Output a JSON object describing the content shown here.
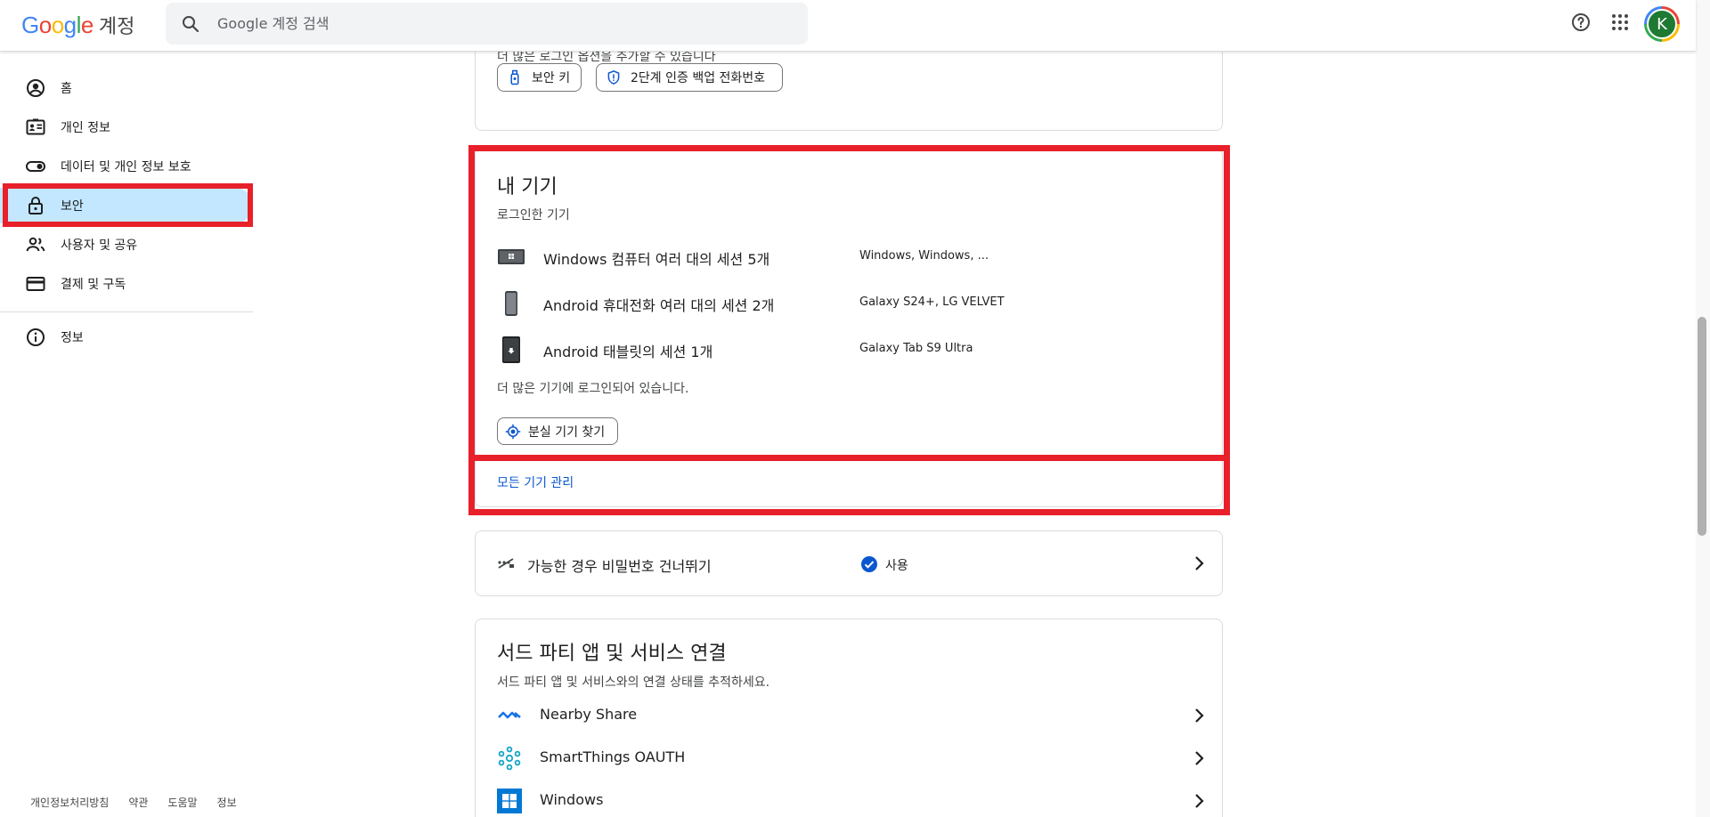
{
  "header": {
    "logo_text": "Google",
    "product": "계정",
    "search_placeholder": "Google 계정 검색",
    "avatar_initial": "K",
    "icons": [
      "search-icon",
      "help-icon",
      "apps-grid-icon"
    ]
  },
  "sidebar": {
    "items": [
      {
        "label": "홈",
        "icon": "account-circle-icon"
      },
      {
        "label": "개인 정보",
        "icon": "id-card-icon"
      },
      {
        "label": "데이터 및 개인 정보 보호",
        "icon": "toggle-icon"
      },
      {
        "label": "보안",
        "icon": "lock-icon",
        "active": true
      },
      {
        "label": "사용자 및 공유",
        "icon": "people-icon"
      },
      {
        "label": "결제 및 구독",
        "icon": "credit-card-icon"
      }
    ],
    "info_item": {
      "label": "정보",
      "icon": "info-icon"
    },
    "footer_links": [
      "개인정보처리방침",
      "약관",
      "도움말",
      "정보"
    ]
  },
  "signin_options": {
    "hint": "더 많은 로그인 옵션을 추가할 수 있습니다",
    "chips": [
      {
        "label": "보안 키",
        "icon": "security-key-icon"
      },
      {
        "label": "2단계 인증 백업 전화번호",
        "icon": "shield-icon"
      }
    ]
  },
  "devices": {
    "title": "내 기기",
    "subtitle": "로그인한 기기",
    "rows": [
      {
        "name": "Windows 컴퓨터 여러 대의 세션 5개",
        "detail": "Windows, Windows, ...",
        "icon": "computer-icon"
      },
      {
        "name": "Android 휴대전화 여러 대의 세션 2개",
        "detail": "Galaxy S24+, LG VELVET",
        "icon": "phone-icon"
      },
      {
        "name": "Android 태블릿의 세션 1개",
        "detail": "Galaxy Tab S9 Ultra",
        "icon": "tablet-icon"
      }
    ],
    "more_text": "더 많은 기기에 로그인되어 있습니다.",
    "find_button": "분실 기기 찾기",
    "manage_link": "모든 기기 관리"
  },
  "skip_password": {
    "label": "가능한 경우 비밀번호 건너뛰기",
    "status": "사용"
  },
  "third_party": {
    "title": "서드 파티 앱 및 서비스 연결",
    "subtitle": "서드 파티 앱 및 서비스와의 연결 상태를 추적하세요.",
    "rows": [
      {
        "name": "Nearby Share",
        "icon": "nearby-share-icon"
      },
      {
        "name": "SmartThings OAUTH",
        "icon": "smartthings-icon"
      },
      {
        "name": "Windows",
        "icon": "windows-logo-icon"
      }
    ]
  },
  "colors": {
    "highlight": "#e8202a",
    "active_nav": "#c2e7ff",
    "link": "#0b57d0"
  }
}
